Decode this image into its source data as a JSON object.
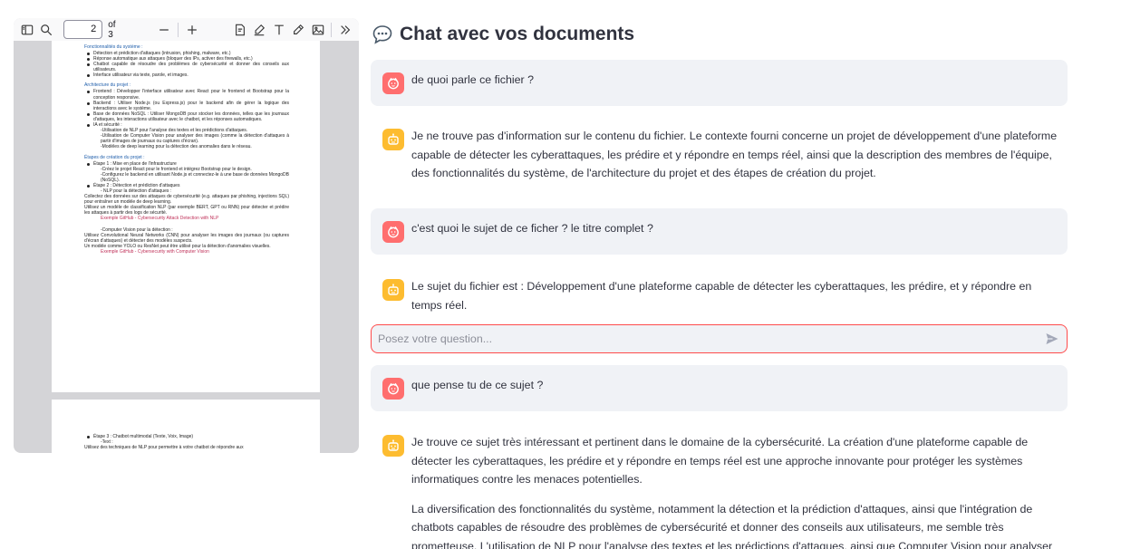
{
  "pdf": {
    "toolbar": {
      "page_value": "2",
      "page_count": "of 3",
      "tools": [
        "sidebar-toggle-icon",
        "search-icon",
        "zoom-out-icon",
        "zoom-in-icon",
        "text-select-icon",
        "highlight-icon",
        "add-text-icon",
        "draw-icon",
        "add-image-icon",
        "more-tools-icon"
      ]
    },
    "page2": [
      {
        "k": "h",
        "t": "Fonctionnalités du système :"
      },
      {
        "k": "b",
        "t": "Détection et prédiction d'attaques (intrusion, phishing, malware, etc.)"
      },
      {
        "k": "b",
        "t": "Réponse automatique aux attaques (bloquer des IPs, activer des firewalls, etc.)"
      },
      {
        "k": "b",
        "t": "Chatbot capable de résoudre des problèmes de cybersécurité et donner des conseils aux utilisateurs."
      },
      {
        "k": "b",
        "t": "Interface utilisateur via texte, parole, et images."
      },
      {
        "k": "h",
        "t": "Architecture du projet :"
      },
      {
        "k": "b",
        "t": "Frontend : Développer l'interface utilisateur avec React pour le frontend et Bootstrap pour la conception responsive."
      },
      {
        "k": "b",
        "t": "Backend : Utiliser Node.js (ou Express.js) pour le backend afin de gérer la logique des interactions avec le système."
      },
      {
        "k": "b",
        "t": "Base de données NoSQL : Utiliser MongoDB pour stocker les données, telles que les journaux d'attaques, les interactions utilisateur avec le chatbot, et les réponses automatiques."
      },
      {
        "k": "b",
        "t": "IA et sécurité :"
      },
      {
        "k": "s",
        "t": "-Utilisation de NLP pour l'analyse des textes et les prédictions d'attaques."
      },
      {
        "k": "s",
        "t": "-Utilisation de Computer Vision pour analyser des images (comme la détection d'attaques à partir d'images de journaux ou captures d'écran)."
      },
      {
        "k": "s",
        "t": "-Modèles de deep learning pour la détection des anomalies dans le réseau."
      },
      {
        "k": "h",
        "t": "Étapes de création du projet :"
      },
      {
        "k": "b",
        "t": "Étape 1 : Mise en place de l'infrastructure"
      },
      {
        "k": "s",
        "t": "-Créez le projet React pour le frontend et intégrez Bootstrap pour le design."
      },
      {
        "k": "s",
        "t": "-Configurez le backend en utilisant Node.js et connectez-le à une base de données MongoDB (NoSQL)."
      },
      {
        "k": "b",
        "t": "Étape 2 : Détection et prédiction d'attaques"
      },
      {
        "k": "s",
        "t": "- NLP pour la détection d'attaques :"
      },
      {
        "k": "l",
        "t": "Collectez des données sur des attaques de cybersécurité (e.g. attaques par phishing, injections SQL) pour entraîner un modèle de deep learning."
      },
      {
        "k": "l",
        "t": "Utilisez un modèle de classification NLP (par exemple BERT, GPT ou RNN) pour détecter et prédire les attaques à partir des logs de sécurité."
      },
      {
        "k": "link",
        "t": "Exemple GitHub - Cybersecurity Attack Detection with NLP"
      },
      {
        "k": "sp",
        "t": ""
      },
      {
        "k": "s",
        "t": "-Computer Vision pour la détection :"
      },
      {
        "k": "l",
        "t": "Utilisez Convolutional Neural Networks (CNN) pour analyser les images des journaux (ou captures d'écran d'attaques) et détecter des modèles suspects."
      },
      {
        "k": "l",
        "t": "Un modèle comme YOLO ou ResNet peut être utilisé pour la détection d'anomalies visuelles."
      },
      {
        "k": "link",
        "t": "Exemple GitHub - Cybersecurity with Computer Vision"
      }
    ],
    "page3": [
      {
        "k": "b",
        "t": "Étape 3 : Chatbot multimodal (Texte, Voix, Image)"
      },
      {
        "k": "s",
        "t": "-Text :"
      },
      {
        "k": "l",
        "t": "Utilisez des techniques de NLP pour permettre à votre chatbot de répondre aux"
      }
    ]
  },
  "chat": {
    "title_icon": "speech-balloon-icon",
    "title": "Chat avec vos documents",
    "input_placeholder": "Posez votre question...",
    "colors": {
      "user_avatar": "#ff6e6e",
      "bot_avatar": "#fdbc30",
      "accent": "#ff4b4b"
    },
    "messages": [
      {
        "role": "user",
        "paragraphs": [
          "de quoi parle ce fichier ?"
        ]
      },
      {
        "role": "assistant",
        "paragraphs": [
          "Je ne trouve pas d'information sur le contenu du fichier. Le contexte fourni concerne un projet de développement d'une plateforme capable de détecter les cyberattaques, les prédire et y répondre en temps réel, ainsi que la description des membres de l'équipe, des fonctionnalités du système, de l'architecture du projet et des étapes de création du projet."
        ]
      },
      {
        "role": "user",
        "paragraphs": [
          "c'est quoi le sujet de ce ficher ? le titre complet ?"
        ]
      },
      {
        "role": "assistant",
        "paragraphs": [
          "Le sujet du fichier est : Développement d'une plateforme capable de détecter les cyberattaques, les prédire, et y répondre en temps réel."
        ]
      },
      {
        "role": "user",
        "paragraphs": [
          "que pense tu de ce sujet ?"
        ]
      },
      {
        "role": "assistant",
        "paragraphs": [
          "Je trouve ce sujet très intéressant et pertinent dans le domaine de la cybersécurité. La création d'une plateforme capable de détecter les cyberattaques, les prédire et y répondre en temps réel est une approche innovante pour protéger les systèmes informatiques contre les menaces potentielles.",
          "La diversification des fonctionnalités du système, notamment la détection et la prédiction d'attaques, ainsi que l'intégration de chatbots capables de résoudre des problèmes de cybersécurité et donner des conseils aux utilisateurs, me semble très prometteuse. L'utilisation de NLP pour l'analyse des textes et les prédictions d'attaques, ainsi que Computer Vision pour analyser des images, constitue un"
        ]
      }
    ]
  }
}
